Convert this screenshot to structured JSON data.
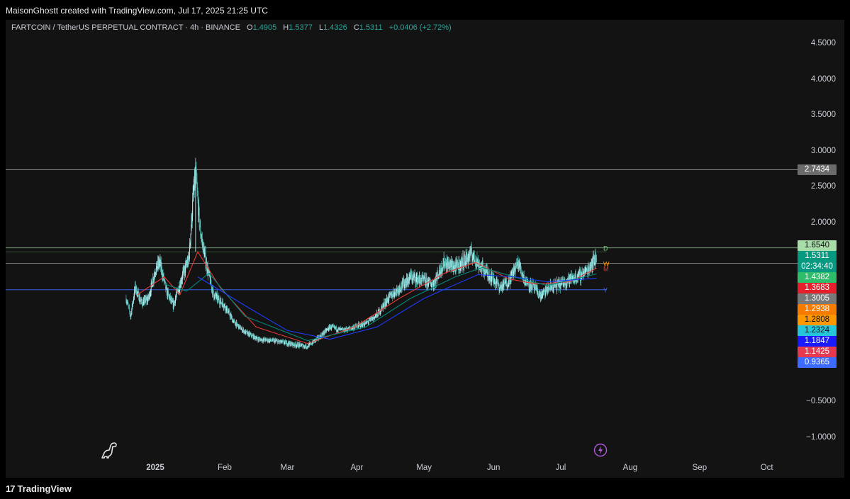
{
  "attribution": "MaisonGhostt created with TradingView.com, Jul 17, 2025 21:25 UTC",
  "header": {
    "symbol": "FARTCOIN / TetherUS PERPETUAL CONTRACT · 4h · BINANCE",
    "o_label": "O",
    "o": "1.4905",
    "h_label": "H",
    "h": "1.5377",
    "l_label": "L",
    "l": "1.4326",
    "c_label": "C",
    "c": "1.5311",
    "change": "+0.0406 (+2.72%)"
  },
  "price_axis": [
    "4.5000",
    "4.0000",
    "3.5000",
    "3.0000",
    "2.5000",
    "2.0000",
    "−0.5000",
    "−1.0000"
  ],
  "time_axis": [
    "2025",
    "Feb",
    "Mar",
    "Apr",
    "May",
    "Jun",
    "Jul",
    "Aug",
    "Sep",
    "Oct"
  ],
  "price_labels": [
    {
      "text": "2.7434",
      "bg": "#6b6b6b",
      "fg": "#ffffff"
    },
    {
      "text": "1.6540",
      "bg": "#a8dca8",
      "fg": "#111111"
    },
    {
      "text": "1.5311",
      "bg": "#089981",
      "fg": "#ffffff"
    },
    {
      "text": "02:34:40",
      "bg": "#089981",
      "fg": "#ffffff"
    },
    {
      "text": "1.4382",
      "bg": "#2ebd6a",
      "fg": "#ffffff"
    },
    {
      "text": "1.3683",
      "bg": "#e5202c",
      "fg": "#ffffff"
    },
    {
      "text": "1.3005",
      "bg": "#787878",
      "fg": "#ffffff"
    },
    {
      "text": "1.2938",
      "bg": "#f57c00",
      "fg": "#ffffff"
    },
    {
      "text": "1.2808",
      "bg": "#ff9800",
      "fg": "#111111"
    },
    {
      "text": "1.2324",
      "bg": "#26c6da",
      "fg": "#111111"
    },
    {
      "text": "1.1847",
      "bg": "#1a1aff",
      "fg": "#ffffff"
    },
    {
      "text": "1.1425",
      "bg": "#e53950",
      "fg": "#ffffff"
    },
    {
      "text": "0.9365",
      "bg": "#3d6bff",
      "fg": "#ffffff"
    }
  ],
  "level_tags": [
    "D",
    "W",
    "M",
    "Y"
  ],
  "footer": {
    "logo": "TradingView",
    "logo_mark": "17"
  },
  "colors": {
    "up": "#26a69a",
    "down": "#ef5350",
    "candle": "#b2ebf2",
    "ema_red": "#e53935",
    "ema_green": "#00897b",
    "ema_blue": "#1e3cff",
    "d_level": "#7ec87e",
    "w_level": "#ff9800",
    "m_level": "#e53935",
    "y_level": "#3d6bff"
  },
  "chart_data": {
    "type": "candlestick",
    "symbol": "FARTCOIN / TetherUS PERPETUAL CONTRACT",
    "interval": "4h",
    "exchange": "BINANCE",
    "ylim": [
      -1.25,
      4.75
    ],
    "x_range": [
      "2024-12-17",
      "2025-10-15"
    ],
    "horizontal_levels": [
      2.7434,
      1.654,
      1.4382,
      1.07
    ],
    "close_path": [
      {
        "d": "2024-12-19",
        "v": 0.95
      },
      {
        "d": "2024-12-21",
        "v": 0.7
      },
      {
        "d": "2024-12-23",
        "v": 1.1
      },
      {
        "d": "2024-12-26",
        "v": 0.88
      },
      {
        "d": "2024-12-29",
        "v": 0.95
      },
      {
        "d": "2025-01-01",
        "v": 1.35
      },
      {
        "d": "2025-01-03",
        "v": 1.45
      },
      {
        "d": "2025-01-06",
        "v": 1.05
      },
      {
        "d": "2025-01-09",
        "v": 0.85
      },
      {
        "d": "2025-01-13",
        "v": 1.25
      },
      {
        "d": "2025-01-16",
        "v": 1.5
      },
      {
        "d": "2025-01-18",
        "v": 2.4
      },
      {
        "d": "2025-01-19",
        "v": 2.7
      },
      {
        "d": "2025-01-21",
        "v": 1.9
      },
      {
        "d": "2025-01-24",
        "v": 1.4
      },
      {
        "d": "2025-01-27",
        "v": 1.0
      },
      {
        "d": "2025-02-01",
        "v": 0.85
      },
      {
        "d": "2025-02-05",
        "v": 0.62
      },
      {
        "d": "2025-02-10",
        "v": 0.48
      },
      {
        "d": "2025-02-16",
        "v": 0.38
      },
      {
        "d": "2025-02-22",
        "v": 0.36
      },
      {
        "d": "2025-02-28",
        "v": 0.33
      },
      {
        "d": "2025-03-05",
        "v": 0.3
      },
      {
        "d": "2025-03-10",
        "v": 0.28
      },
      {
        "d": "2025-03-15",
        "v": 0.4
      },
      {
        "d": "2025-03-20",
        "v": 0.55
      },
      {
        "d": "2025-03-26",
        "v": 0.5
      },
      {
        "d": "2025-03-31",
        "v": 0.55
      },
      {
        "d": "2025-04-05",
        "v": 0.6
      },
      {
        "d": "2025-04-10",
        "v": 0.72
      },
      {
        "d": "2025-04-15",
        "v": 0.95
      },
      {
        "d": "2025-04-20",
        "v": 1.1
      },
      {
        "d": "2025-04-25",
        "v": 1.25
      },
      {
        "d": "2025-04-30",
        "v": 1.2
      },
      {
        "d": "2025-05-05",
        "v": 1.15
      },
      {
        "d": "2025-05-10",
        "v": 1.45
      },
      {
        "d": "2025-05-15",
        "v": 1.38
      },
      {
        "d": "2025-05-20",
        "v": 1.5
      },
      {
        "d": "2025-05-22",
        "v": 1.58
      },
      {
        "d": "2025-05-26",
        "v": 1.4
      },
      {
        "d": "2025-05-31",
        "v": 1.25
      },
      {
        "d": "2025-06-04",
        "v": 1.1
      },
      {
        "d": "2025-06-08",
        "v": 1.2
      },
      {
        "d": "2025-06-12",
        "v": 1.45
      },
      {
        "d": "2025-06-15",
        "v": 1.2
      },
      {
        "d": "2025-06-19",
        "v": 1.1
      },
      {
        "d": "2025-06-22",
        "v": 0.98
      },
      {
        "d": "2025-06-26",
        "v": 1.1
      },
      {
        "d": "2025-07-01",
        "v": 1.15
      },
      {
        "d": "2025-07-05",
        "v": 1.22
      },
      {
        "d": "2025-07-09",
        "v": 1.25
      },
      {
        "d": "2025-07-13",
        "v": 1.35
      },
      {
        "d": "2025-07-15",
        "v": 1.45
      },
      {
        "d": "2025-07-17",
        "v": 1.53
      }
    ],
    "ema_red": [
      {
        "d": "2024-12-24",
        "v": 1.0
      },
      {
        "d": "2025-01-05",
        "v": 1.25
      },
      {
        "d": "2025-01-12",
        "v": 1.0
      },
      {
        "d": "2025-01-20",
        "v": 1.6
      },
      {
        "d": "2025-01-30",
        "v": 1.1
      },
      {
        "d": "2025-02-15",
        "v": 0.55
      },
      {
        "d": "2025-03-10",
        "v": 0.32
      },
      {
        "d": "2025-03-31",
        "v": 0.55
      },
      {
        "d": "2025-04-20",
        "v": 0.95
      },
      {
        "d": "2025-05-10",
        "v": 1.3
      },
      {
        "d": "2025-05-24",
        "v": 1.45
      },
      {
        "d": "2025-06-08",
        "v": 1.22
      },
      {
        "d": "2025-06-20",
        "v": 1.15
      },
      {
        "d": "2025-07-05",
        "v": 1.18
      },
      {
        "d": "2025-07-17",
        "v": 1.37
      }
    ],
    "ema_green": [
      {
        "d": "2025-01-05",
        "v": 1.15
      },
      {
        "d": "2025-01-15",
        "v": 1.05
      },
      {
        "d": "2025-01-25",
        "v": 1.3
      },
      {
        "d": "2025-02-10",
        "v": 0.7
      },
      {
        "d": "2025-03-10",
        "v": 0.36
      },
      {
        "d": "2025-04-05",
        "v": 0.55
      },
      {
        "d": "2025-04-25",
        "v": 0.95
      },
      {
        "d": "2025-05-15",
        "v": 1.25
      },
      {
        "d": "2025-05-27",
        "v": 1.38
      },
      {
        "d": "2025-06-10",
        "v": 1.25
      },
      {
        "d": "2025-06-25",
        "v": 1.13
      },
      {
        "d": "2025-07-17",
        "v": 1.29
      }
    ],
    "ema_blue": [
      {
        "d": "2025-01-20",
        "v": 1.25
      },
      {
        "d": "2025-02-10",
        "v": 0.85
      },
      {
        "d": "2025-03-01",
        "v": 0.5
      },
      {
        "d": "2025-03-20",
        "v": 0.38
      },
      {
        "d": "2025-04-10",
        "v": 0.55
      },
      {
        "d": "2025-05-01",
        "v": 0.95
      },
      {
        "d": "2025-05-25",
        "v": 1.28
      },
      {
        "d": "2025-06-10",
        "v": 1.25
      },
      {
        "d": "2025-06-25",
        "v": 1.18
      },
      {
        "d": "2025-07-17",
        "v": 1.23
      }
    ],
    "level_tag_values": {
      "D": 1.654,
      "W": 1.4382,
      "M": 1.3683,
      "Y": 1.07
    }
  }
}
